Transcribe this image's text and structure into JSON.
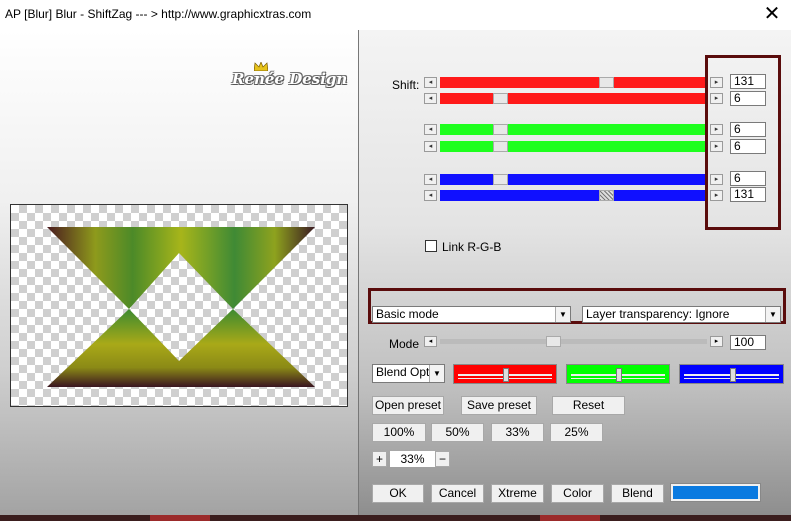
{
  "window": {
    "title": "AP [Blur]  Blur - ShiftZag    --- > http://www.graphicxtras.com",
    "close_glyph": "✕"
  },
  "preview": {
    "logo_text": "Renée Design"
  },
  "shift": {
    "label": "Shift:",
    "sliders": [
      {
        "color": "#ff1a1a",
        "value": "131",
        "level": 0.63
      },
      {
        "color": "#ff1a1a",
        "value": "6",
        "level": 0.21
      },
      {
        "color": "#1eff1e",
        "value": "6",
        "level": 0.21
      },
      {
        "color": "#1eff1e",
        "value": "6",
        "level": 0.21
      },
      {
        "color": "#1010ff",
        "value": "6",
        "level": 0.21
      },
      {
        "color": "#1010ff",
        "value": "131",
        "level": 0.63
      }
    ]
  },
  "link_rgb": {
    "label": "Link R-G-B",
    "checked": false
  },
  "mode_select": {
    "value": "Basic mode"
  },
  "transparency_select": {
    "value": "Layer transparency: Ignore"
  },
  "mode": {
    "label": "Mode",
    "value": "100",
    "level": 0.42
  },
  "blend_select": {
    "value": "Blend Optio"
  },
  "color_swatches": [
    {
      "color": "#ff0000",
      "level": 0.5
    },
    {
      "color": "#00ff00",
      "level": 0.5
    },
    {
      "color": "#0000ff",
      "level": 0.5
    }
  ],
  "buttons": {
    "open_preset": "Open preset",
    "save_preset": "Save preset",
    "reset": "Reset",
    "zoom_100": "100%",
    "zoom_50": "50%",
    "zoom_33": "33%",
    "zoom_25": "25%",
    "zoom_plus": "+",
    "zoom_minus": "−",
    "zoom_value": "33%",
    "ok": "OK",
    "cancel": "Cancel",
    "xtreme": "Xtreme",
    "color": "Color",
    "blend": "Blend"
  },
  "accent_color": "#0a7ae0"
}
